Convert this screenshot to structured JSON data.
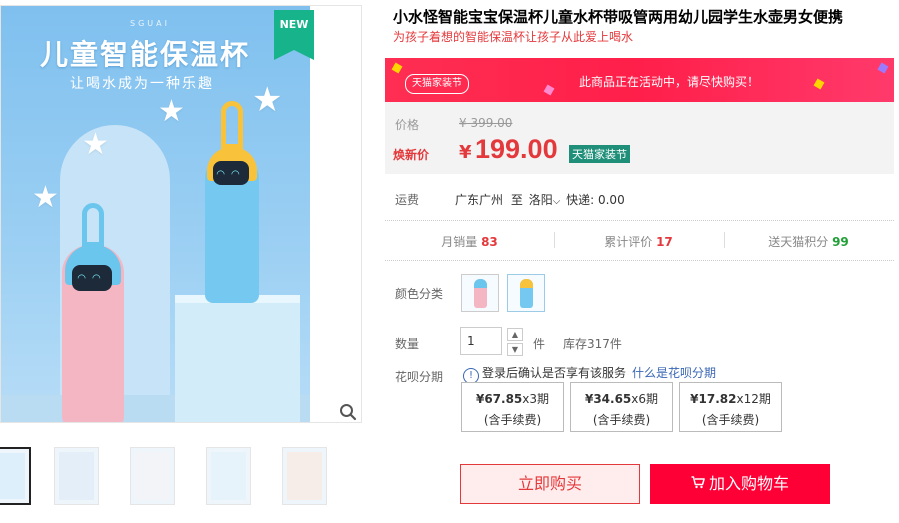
{
  "gallery": {
    "badge": "NEW",
    "brand_mark": "SGUAI",
    "hero_title": "儿童智能保温杯",
    "hero_subtitle": "让喝水成为一种乐趣",
    "zoom_icon": "magnifier-icon",
    "thumbnails": [
      {
        "label": "thumbnail-1",
        "bg": "#dceffa"
      },
      {
        "label": "thumbnail-2",
        "bg": "#e3eef8"
      },
      {
        "label": "thumbnail-3",
        "bg": "#f2f4f8"
      },
      {
        "label": "thumbnail-4",
        "bg": "#e6f3fb"
      },
      {
        "label": "thumbnail-5",
        "bg": "#f6ece8"
      }
    ]
  },
  "product": {
    "title": "小水怪智能宝宝保温杯儿童水杯带吸管两用幼儿园学生水壶男女便携",
    "subtitle": "为孩子着想的智能保温杯让孩子从此爱上喝水"
  },
  "promo": {
    "tag": "天猫家装节",
    "text": "此商品正在活动中，请尽快购买！"
  },
  "price": {
    "orig_label": "价格",
    "orig_value": "¥ 399.00",
    "new_label": "焕新价",
    "currency": "¥",
    "new_value": "199.00",
    "badge": "天猫家装节"
  },
  "shipping": {
    "label": "运费",
    "from": "广东广州",
    "to_word": "至",
    "to": "洛阳",
    "fee": "快递: 0.00"
  },
  "stats": {
    "monthly_label": "月销量",
    "monthly_value": "83",
    "reviews_label": "累计评价",
    "reviews_value": "17",
    "points_label": "送天猫积分",
    "points_value": "99"
  },
  "options": {
    "color_label": "颜色分类",
    "qty_label": "数量",
    "qty_value": "1",
    "unit": "件",
    "stock": "库存317件"
  },
  "huabei": {
    "label": "花呗分期",
    "note": "登录后确认是否享有该服务",
    "link": "什么是花呗分期",
    "plans": [
      {
        "amount": "¥67.85",
        "period": "x3期",
        "fee": "(含手续费)"
      },
      {
        "amount": "¥34.65",
        "period": "x6期",
        "fee": "(含手续费)"
      },
      {
        "amount": "¥17.82",
        "period": "x12期",
        "fee": "(含手续费)"
      }
    ]
  },
  "actions": {
    "buy_now": "立即购买",
    "add_to_cart": "加入购物车"
  },
  "colors": {
    "accent_red": "#e4393c",
    "tmall_red": "#ff0036",
    "link_blue": "#3a67b5",
    "points_green": "#22a037"
  }
}
